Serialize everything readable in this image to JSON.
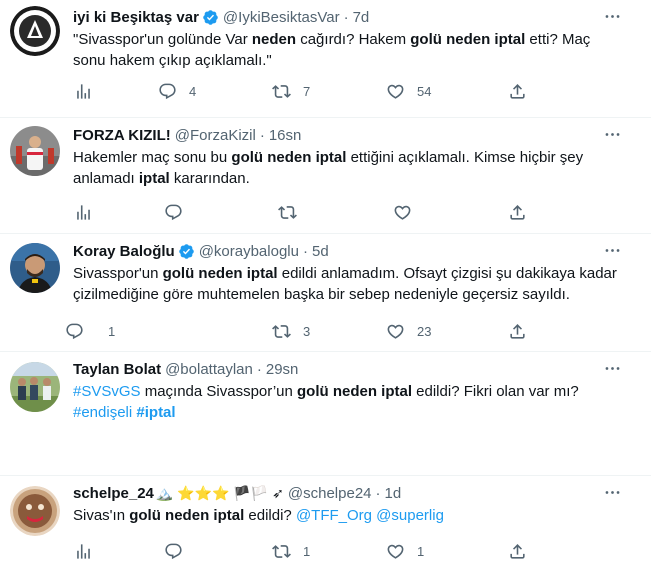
{
  "tweets": [
    {
      "name": "iyi ki Beşiktaş var",
      "verified": true,
      "handle": "@IykiBesiktasVar",
      "time": "7d",
      "text_segments": [
        {
          "t": "\"Sivasspor'un golünde Var "
        },
        {
          "t": "neden",
          "b": true
        },
        {
          "t": " cağırdı? Hakem "
        },
        {
          "t": "golü neden iptal",
          "b": true
        },
        {
          "t": " etti? Maç sonu hakem çıkıp açıklamalı.\""
        }
      ],
      "replies": "4",
      "retweets": "7",
      "likes": "54"
    },
    {
      "name": "FORZA KIZIL!",
      "verified": false,
      "handle": "@ForzaKizil",
      "time": "16sn",
      "text_segments": [
        {
          "t": "Hakemler maç sonu bu "
        },
        {
          "t": "golü neden iptal",
          "b": true
        },
        {
          "t": " ettiğini açıklamalı. Kimse hiçbir şey anlamadı "
        },
        {
          "t": "iptal",
          "b": true
        },
        {
          "t": " kararından."
        }
      ],
      "replies": "",
      "retweets": "",
      "likes": ""
    },
    {
      "name": "Koray Baloğlu",
      "verified": true,
      "handle": "@koraybaloglu",
      "time": "5d",
      "text_segments": [
        {
          "t": "Sivasspor'un "
        },
        {
          "t": "golü neden iptal",
          "b": true
        },
        {
          "t": " edildi anlamadım. Ofsayt çizgisi şu dakikaya kadar çizilmediğine göre muhtemelen başka bir sebep nedeniyle geçersiz sayıldı."
        }
      ],
      "replies": "1",
      "retweets": "3",
      "likes": "23"
    },
    {
      "name": "Taylan Bolat",
      "verified": false,
      "handle": "@bolattaylan",
      "time": "29sn",
      "text_segments": [
        {
          "t": "#SVSvGS",
          "link": true
        },
        {
          "t": " maçında Sivasspor’un "
        },
        {
          "t": "golü neden iptal",
          "b": true
        },
        {
          "t": " edildi? Fikri olan var mı? "
        },
        {
          "t": "#endişeli",
          "link": true
        },
        {
          "t": " "
        },
        {
          "t": "#iptal",
          "link": true,
          "b": true
        }
      ],
      "replies": "",
      "retweets": "",
      "likes": ""
    },
    {
      "name": "schelpe_24",
      "name_emojis": "🏔️ ⭐⭐⭐ 🏴🏳️ ➶",
      "verified": false,
      "handle": "@schelpe24",
      "time": "1d",
      "text_segments": [
        {
          "t": "Sivas'ın "
        },
        {
          "t": "golü neden iptal",
          "b": true
        },
        {
          "t": " edildi? "
        },
        {
          "t": "@TFF_Org",
          "link": true
        },
        {
          "t": " "
        },
        {
          "t": "@superlig",
          "link": true
        }
      ],
      "replies": "",
      "retweets": "1",
      "likes": "1"
    }
  ],
  "icons": {
    "analytics": "analytics-icon",
    "reply": "reply-icon",
    "retweet": "retweet-icon",
    "like": "heart-icon",
    "share": "share-icon",
    "more": "more-icon",
    "verified": "verified-badge-icon"
  },
  "colors": {
    "text": "#0f1419",
    "secondary": "#536471",
    "link": "#1d9bf0",
    "border": "#eff3f4"
  }
}
